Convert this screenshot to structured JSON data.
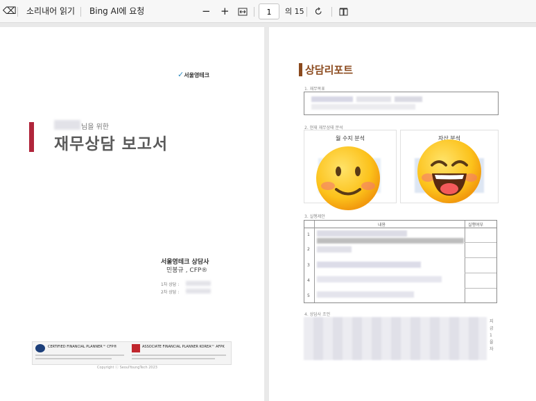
{
  "toolbar": {
    "eraser_icon": "eraser-icon",
    "read_aloud": "소리내어 읽기",
    "ask_bing": "Bing AI에 요청",
    "zoom_out": "−",
    "zoom_in": "+",
    "fit_icon": "fit-width-icon",
    "page_number": "1",
    "page_total": "의 15",
    "rotate_icon": "rotate-icon",
    "view_icon": "page-view-icon"
  },
  "cover": {
    "logo_text": "서울영테크",
    "for_label": "님을 위한",
    "title": "재무상담 보고서",
    "company": "서울영테크 상담사",
    "advisor": "민봉규 , CFP®",
    "session1_label": "1차 상담 :",
    "session2_label": "2차 상담 :",
    "cfp_badge": "CERTIFIED FINANCIAL PLANNER™ CFP®",
    "afpk_badge": "ASSOCIATE FINANCIAL PLANNER KOREA™ AFPK",
    "copyright": "Copyright ⓒ SeoulYoungTech 2023"
  },
  "report": {
    "heading": "상담리포트",
    "section1": "1. 재무목표",
    "section2": "2. 현재 재무상태 분석",
    "monthly_analysis": "월 수지 분석",
    "asset_analysis": "자산 분석",
    "section3": "3. 실행제안",
    "col_content": "내용",
    "col_status": "실행여부",
    "rows": [
      "1",
      "2",
      "3",
      "4",
      "5"
    ],
    "section4": "4. 상담사 조언",
    "side_note": [
      "지",
      "금",
      "1",
      "을",
      "자"
    ]
  },
  "emoji": {
    "left": "blushing-smile-emoji",
    "right": "grinning-emoji"
  }
}
